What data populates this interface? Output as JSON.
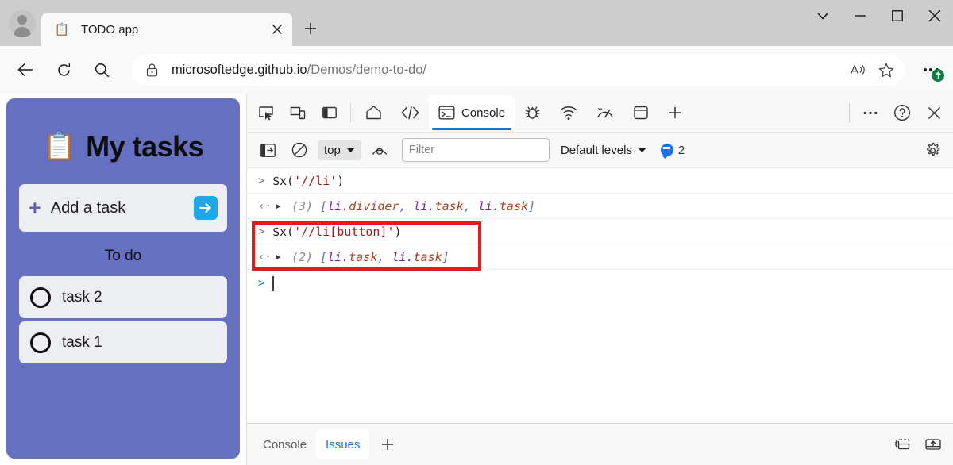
{
  "window": {
    "controls": [
      {
        "name": "tab-search",
        "icon": "chevron-down-icon"
      },
      {
        "name": "minimize",
        "icon": "minimize-icon"
      },
      {
        "name": "maximize",
        "icon": "maximize-icon"
      },
      {
        "name": "close",
        "icon": "close-icon"
      }
    ]
  },
  "tabstrip": {
    "profile_label": "Profile",
    "tab": {
      "favicon": "📋",
      "title": "TODO app",
      "close_label": "×"
    },
    "new_tab_label": "+"
  },
  "addressbar": {
    "back_label": "Back",
    "refresh_label": "Refresh",
    "search_label": "Search",
    "lock_label": "Site information",
    "url_domain": "microsoftedge.github.io",
    "url_path": "/Demos/demo-to-do/",
    "read_aloud_label": "Read aloud",
    "favorite_label": "Add to favorites",
    "settings_label": "Settings and more",
    "update_badge": "↑"
  },
  "todo_app": {
    "emoji": "📋",
    "title": "My tasks",
    "add_plus": "+",
    "add_placeholder": "Add a task",
    "add_go_arrow": "➜",
    "section_heading": "To do",
    "tasks": [
      {
        "label": "task 2",
        "checked": false
      },
      {
        "label": "task 1",
        "checked": false
      }
    ],
    "colors": {
      "panel": "#6670c0",
      "card": "#edeef2",
      "go_button": "#1ea7ea",
      "plus": "#5b61b0"
    }
  },
  "devtools": {
    "toolbar_icons": [
      {
        "name": "inspect-element-icon",
        "title": "Inspect"
      },
      {
        "name": "device-emulation-icon",
        "title": "Toggle device emulation"
      },
      {
        "name": "dock-side-icon",
        "title": "Customize and control DevTools"
      }
    ],
    "tabs": [
      {
        "name": "welcome-tab",
        "icon": "home-icon",
        "label": "",
        "active": false
      },
      {
        "name": "elements-tab",
        "icon": "code-icon",
        "label": "",
        "active": false
      },
      {
        "name": "console-tab",
        "icon": "console-icon",
        "label": "Console",
        "active": true
      },
      {
        "name": "sources-tab",
        "icon": "bug-icon",
        "label": "",
        "active": false
      },
      {
        "name": "network-tab",
        "icon": "network-icon",
        "label": "",
        "active": false
      },
      {
        "name": "performance-tab",
        "icon": "gauge-icon",
        "label": "",
        "active": false
      },
      {
        "name": "application-tab",
        "icon": "application-icon",
        "label": "",
        "active": false
      },
      {
        "name": "more-tabs-tab",
        "icon": "plus-icon",
        "label": "",
        "active": false
      }
    ],
    "tabbar_right": [
      {
        "name": "more-options-icon",
        "label": "…"
      },
      {
        "name": "help-icon",
        "label": "?"
      },
      {
        "name": "close-devtools-icon",
        "label": "×"
      }
    ],
    "console_toolbar": {
      "sidebar_toggle": "console-sidebar-icon",
      "clear_console": "clear-console-icon",
      "context": "top",
      "context_chevron": "▼",
      "live_expression": "eye-icon",
      "filter_placeholder": "Filter",
      "filter_value": "",
      "levels": "Default levels",
      "levels_chevron": "▼",
      "message_count": "2",
      "settings": "gear-icon"
    },
    "console_lines": [
      {
        "kind": "input",
        "chevron": ">",
        "tokens": [
          {
            "t": "fn",
            "v": "$x("
          },
          {
            "t": "str",
            "v": "'//li'"
          },
          {
            "t": "fn",
            "v": ")"
          }
        ]
      },
      {
        "kind": "output",
        "chevron": "‹·",
        "disclosure": "▶",
        "tokens": [
          {
            "t": "count",
            "v": "(3) "
          },
          {
            "t": "brk",
            "v": "["
          },
          {
            "t": "tag",
            "v": "li."
          },
          {
            "t": "cls",
            "v": "divider"
          },
          {
            "t": "comma",
            "v": ", "
          },
          {
            "t": "tag",
            "v": "li."
          },
          {
            "t": "cls",
            "v": "task"
          },
          {
            "t": "comma",
            "v": ", "
          },
          {
            "t": "tag",
            "v": "li."
          },
          {
            "t": "cls",
            "v": "task"
          },
          {
            "t": "brk",
            "v": "]"
          }
        ]
      },
      {
        "kind": "input",
        "chevron": ">",
        "tokens": [
          {
            "t": "fn",
            "v": "$x("
          },
          {
            "t": "str",
            "v": "'//li[button]'"
          },
          {
            "t": "fn",
            "v": ")"
          }
        ]
      },
      {
        "kind": "output",
        "chevron": "‹·",
        "disclosure": "▶",
        "tokens": [
          {
            "t": "count",
            "v": "(2) "
          },
          {
            "t": "brk",
            "v": "["
          },
          {
            "t": "tag",
            "v": "li."
          },
          {
            "t": "cls",
            "v": "task"
          },
          {
            "t": "comma",
            "v": ", "
          },
          {
            "t": "tag",
            "v": "li."
          },
          {
            "t": "cls",
            "v": "task"
          },
          {
            "t": "brk",
            "v": "]"
          }
        ]
      }
    ],
    "console_prompt": {
      "chevron": ">",
      "value": ""
    },
    "annotation": {
      "color": "#e8191a",
      "label": "highlight-box"
    },
    "drawer": {
      "tabs": [
        {
          "label": "Console",
          "active": false
        },
        {
          "label": "Issues",
          "active": true
        }
      ],
      "add_label": "+",
      "right_icons": [
        {
          "name": "restore-drawer-icon"
        },
        {
          "name": "move-to-top-icon"
        }
      ]
    }
  }
}
